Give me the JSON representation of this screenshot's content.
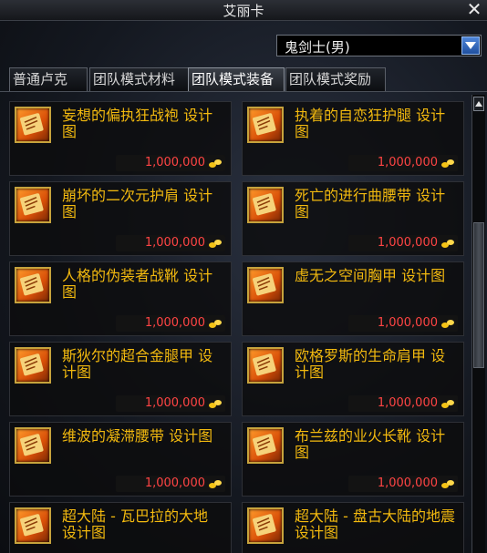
{
  "window": {
    "title": "艾丽卡"
  },
  "class_select": {
    "value": "鬼剑士(男)"
  },
  "tabs": [
    {
      "label": "普通卢克"
    },
    {
      "label": "团队模式材料"
    },
    {
      "label": "团队模式装备"
    },
    {
      "label": "团队模式奖励"
    }
  ],
  "items": [
    {
      "name": "妄想的偏执狂战袍 设计图",
      "price": "1,000,000"
    },
    {
      "name": "执着的自恋狂护腿 设计图",
      "price": "1,000,000"
    },
    {
      "name": "崩坏的二次元护肩 设计图",
      "price": "1,000,000"
    },
    {
      "name": "死亡的进行曲腰带 设计图",
      "price": "1,000,000"
    },
    {
      "name": "人格的伪装者战靴 设计图",
      "price": "1,000,000"
    },
    {
      "name": "虚无之空间胸甲 设计图",
      "price": "1,000,000"
    },
    {
      "name": "斯狄尔的超合金腿甲 设计图",
      "price": "1,000,000"
    },
    {
      "name": "欧格罗斯的生命肩甲 设计图",
      "price": "1,000,000"
    },
    {
      "name": "维波的凝滞腰带 设计图",
      "price": "1,000,000"
    },
    {
      "name": "布兰兹的业火长靴 设计图",
      "price": "1,000,000"
    },
    {
      "name": "超大陆 - 瓦巴拉的大地 设计图",
      "price": ""
    },
    {
      "name": "超大陆 - 盘古大陆的地震 设计图",
      "price": ""
    }
  ],
  "icons": {
    "item": "blueprint-scroll-icon",
    "currency": "gold-coin-icon",
    "close": "close-icon",
    "dropdown": "dropdown-arrow-icon",
    "scroll_up": "scroll-up-arrow-icon"
  },
  "colors": {
    "item_name": "#f2b90f",
    "price": "#ff4444",
    "active_tab": "#3a3f48"
  }
}
